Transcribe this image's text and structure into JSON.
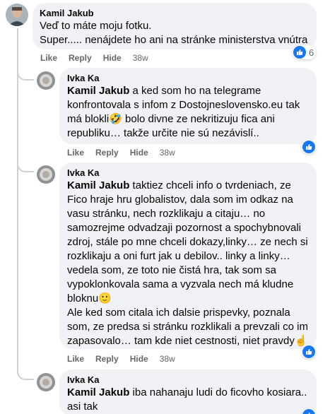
{
  "comment1": {
    "author": "Kamil Jakub",
    "line1": "Veď to máte moju fotku.",
    "line2": "Super..... nenájdete ho ani na stránke ministerstva vnútra",
    "actions": {
      "like": "Like",
      "reply": "Reply",
      "hide": "Hide",
      "time": "38w"
    },
    "reaction_count": "6"
  },
  "reply1": {
    "author": "Ivka Ka",
    "mention": "Kamil Jakub",
    "text": " a ked som ho na telegrame konfrontovala s infom z Dostojneslovensko.eu tak má blokli🤣 bolo divne ze nekritizuju fica ani republiku… takže určite nie sú nezávislí..",
    "actions": {
      "like": "Like",
      "reply": "Reply",
      "hide": "Hide",
      "time": "38w"
    }
  },
  "reply2": {
    "author": "Ivka Ka",
    "mention": "Kamil Jakub",
    "text": " taktiez chceli info o tvrdeniach, ze Fico hraje hru globalistov, dala som im odkaz na vasu stránku, nech rozklikaju a citaju… no samozrejme odvadzaji pozornost a spochybnovali zdroj, stále po mne chceli dokazy,linky… ze nech si rozklikaju a oni furt jak u debilov.. linky a linky… vedela som, ze toto nie čistá hra, tak som sa vypoklonkovala sama a vyzvala nech má kludne bloknu🙂\nAle ked som citala ich dalsie prispevky, poznala som, ze predsa si stránku rozklikali a prevzali co im zapasovalo… tam kde niet cestnosti, niet pravdy☝",
    "actions": {
      "like": "Like",
      "reply": "Reply",
      "hide": "Hide",
      "time": "38w"
    }
  },
  "reply3": {
    "author": "Ivka Ka",
    "mention": "Kamil Jakub",
    "text": " iba nahanaju ludi do ficovho kosiara..\nasi tak"
  },
  "colors": {
    "bubble": "#f0f2f5",
    "like_blue": "#1877f2",
    "meta": "#65676b"
  }
}
